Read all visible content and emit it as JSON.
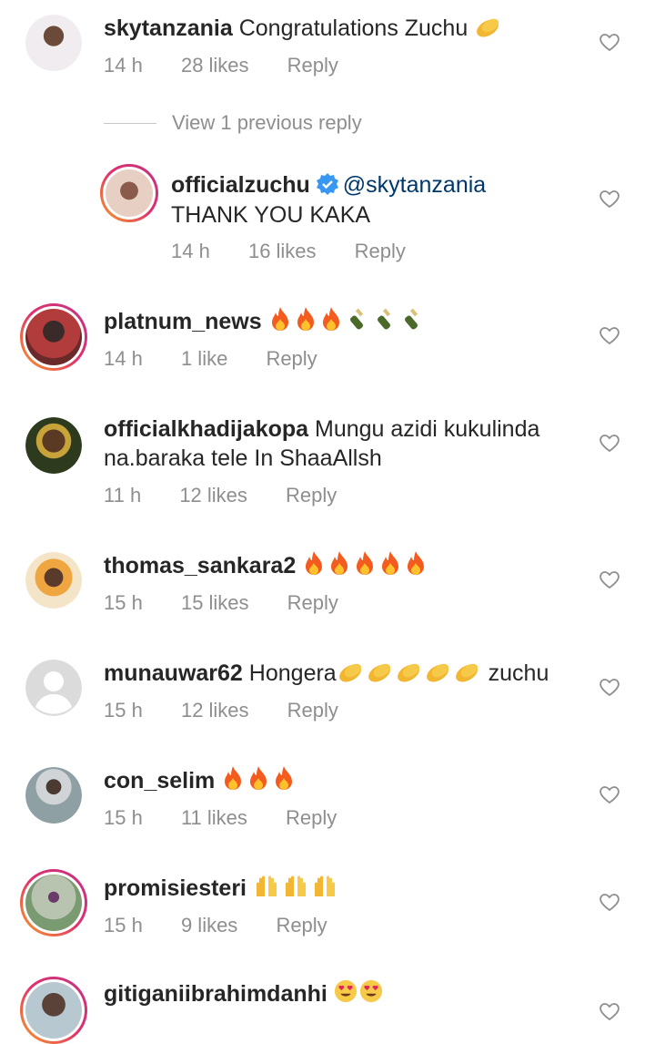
{
  "comments": [
    {
      "username": "skytanzania",
      "text": "Congratulations Zuchu",
      "emoji": [
        "clap"
      ],
      "time": "14 h",
      "likes": "28 likes",
      "reply": "Reply",
      "avatar_color": "#d8d2dc"
    },
    {
      "username": "officialzuchu",
      "mention": "@skytanzania",
      "text": "THANK YOU KAKA",
      "time": "14 h",
      "likes": "16 likes",
      "reply": "Reply",
      "verified": true,
      "avatar_color": "#c9a89a"
    },
    {
      "username": "platnum_news",
      "emoji": [
        "fire",
        "fire",
        "fire",
        "bottle",
        "bottle",
        "bottle"
      ],
      "time": "14 h",
      "likes": "1 like",
      "reply": "Reply",
      "avatar_color": "#b23b3b"
    },
    {
      "username": "officialkhadijakopa",
      "text": "Mungu azidi kukulinda",
      "text2": "na.baraka tele In ShaaAllsh",
      "time": "11 h",
      "likes": "12 likes",
      "reply": "Reply",
      "avatar_color": "#6b4a2e"
    },
    {
      "username": "thomas_sankara2",
      "emoji": [
        "fire",
        "fire",
        "fire",
        "fire",
        "fire"
      ],
      "time": "15 h",
      "likes": "15 likes",
      "reply": "Reply",
      "avatar_color": "#e8a24c"
    },
    {
      "username": "munauwar62",
      "text": "Hongera",
      "text_after": "zuchu",
      "emoji": [
        "clap",
        "clap",
        "clap",
        "clap",
        "clap"
      ],
      "time": "15 h",
      "likes": "12 likes",
      "reply": "Reply",
      "avatar_color": "#dbdbdb"
    },
    {
      "username": "con_selim",
      "emoji": [
        "fire",
        "fire",
        "fire"
      ],
      "time": "15 h",
      "likes": "11 likes",
      "reply": "Reply",
      "avatar_color": "#9aa3a8"
    },
    {
      "username": "promisiesteri",
      "emoji": [
        "hands",
        "hands",
        "hands"
      ],
      "time": "15 h",
      "likes": "9 likes",
      "reply": "Reply",
      "avatar_color": "#8fa98a"
    },
    {
      "username": "gitiganiibrahimdanhi",
      "emoji": [
        "hearteyes",
        "hearteyes"
      ],
      "avatar_color": "#7c6a5e"
    }
  ],
  "view_previous": "View 1 previous reply",
  "colors": {
    "meta": "#8e8e8e",
    "mention": "#00376b",
    "verified": "#3897f0"
  }
}
